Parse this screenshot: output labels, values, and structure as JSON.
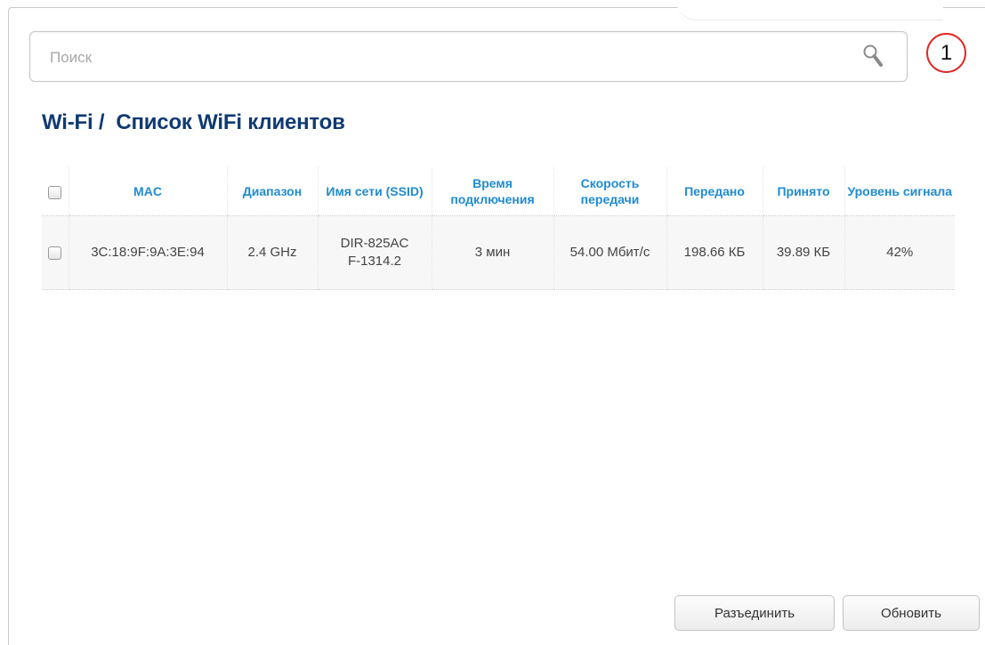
{
  "search": {
    "placeholder": "Поиск"
  },
  "callout": {
    "number": "1"
  },
  "breadcrumb": {
    "section": "Wi-Fi /",
    "page": "Список WiFi клиентов"
  },
  "table": {
    "headers": [
      "MAC",
      "Диапазон",
      "Имя сети (SSID)",
      "Время подключения",
      "Скорость передачи",
      "Передано",
      "Принято",
      "Уровень сигнала"
    ],
    "rows": [
      {
        "mac": "3C:18:9F:9A:3E:94",
        "band": "2.4 GHz",
        "ssid": "DIR-825ACF-1314.2",
        "uptime": "3 мин",
        "rate": "54.00 Мбит/с",
        "sent": "198.66 КБ",
        "received": "39.89 КБ",
        "signal": "42%"
      }
    ]
  },
  "buttons": {
    "disconnect": "Разъединить",
    "refresh": "Обновить"
  },
  "colors": {
    "title": "#0f3a73",
    "header": "#1f8bd1",
    "badge_ring": "#e12727"
  }
}
